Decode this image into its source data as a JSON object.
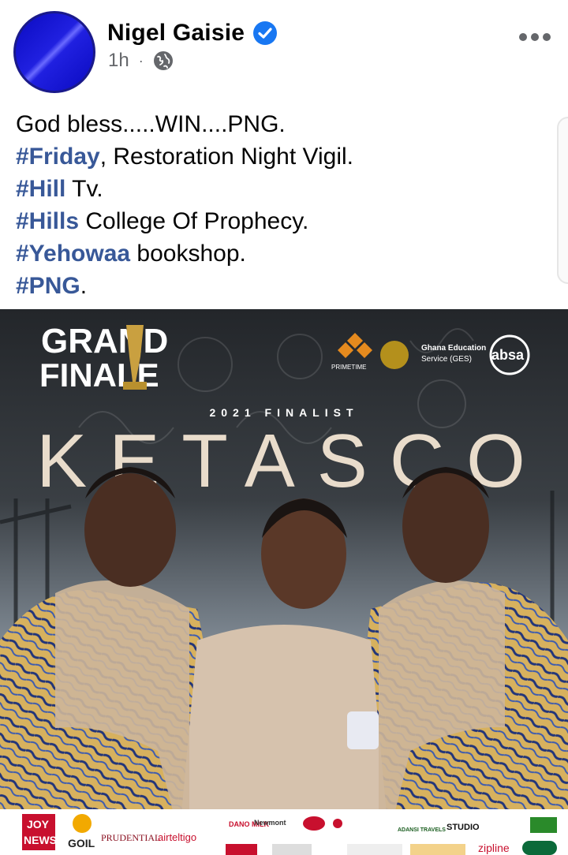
{
  "post": {
    "author": "Nigel Gaisie",
    "timestamp": "1h",
    "separator": "·",
    "privacy_icon": "globe-icon",
    "verified_icon": "verified-badge-icon",
    "more_icon": "more-options-icon",
    "lines": [
      {
        "hashtag": "",
        "text": "God bless.....WIN....PNG."
      },
      {
        "hashtag": "#Friday",
        "text": ", Restoration Night Vigil."
      },
      {
        "hashtag": "#Hill",
        "text": " Tv."
      },
      {
        "hashtag": "#Hills",
        "text": " College Of Prophecy."
      },
      {
        "hashtag": "#Yehowaa",
        "text": " bookshop."
      },
      {
        "hashtag": "#PNG",
        "text": "."
      }
    ]
  },
  "photo": {
    "logo_line1": "GRAND",
    "logo_line2": "FINALE",
    "subtitle": "2021 FINALIST",
    "headline": "KETASCO",
    "sponsor1_top": "Ghana Education",
    "sponsor1_bottom": "Service (GES)",
    "sponsor2": "absa",
    "sponsor3": "PRIMETIME",
    "footer": {
      "joy_top": "JOY",
      "joy_bottom": "NEWS",
      "goil": "GOIL",
      "prudential": "PRUDENTIAL",
      "airteltigo": "airteltigo",
      "dano": "DANO MILK",
      "newmont": "Newmont",
      "adansi": "ADANSI TRAVELS",
      "studio": "STUDIO",
      "zipline": "zipline"
    }
  },
  "colors": {
    "hashtag": "#385898",
    "text": "#050505",
    "meta": "#65676b",
    "verified": "#1877f2"
  }
}
